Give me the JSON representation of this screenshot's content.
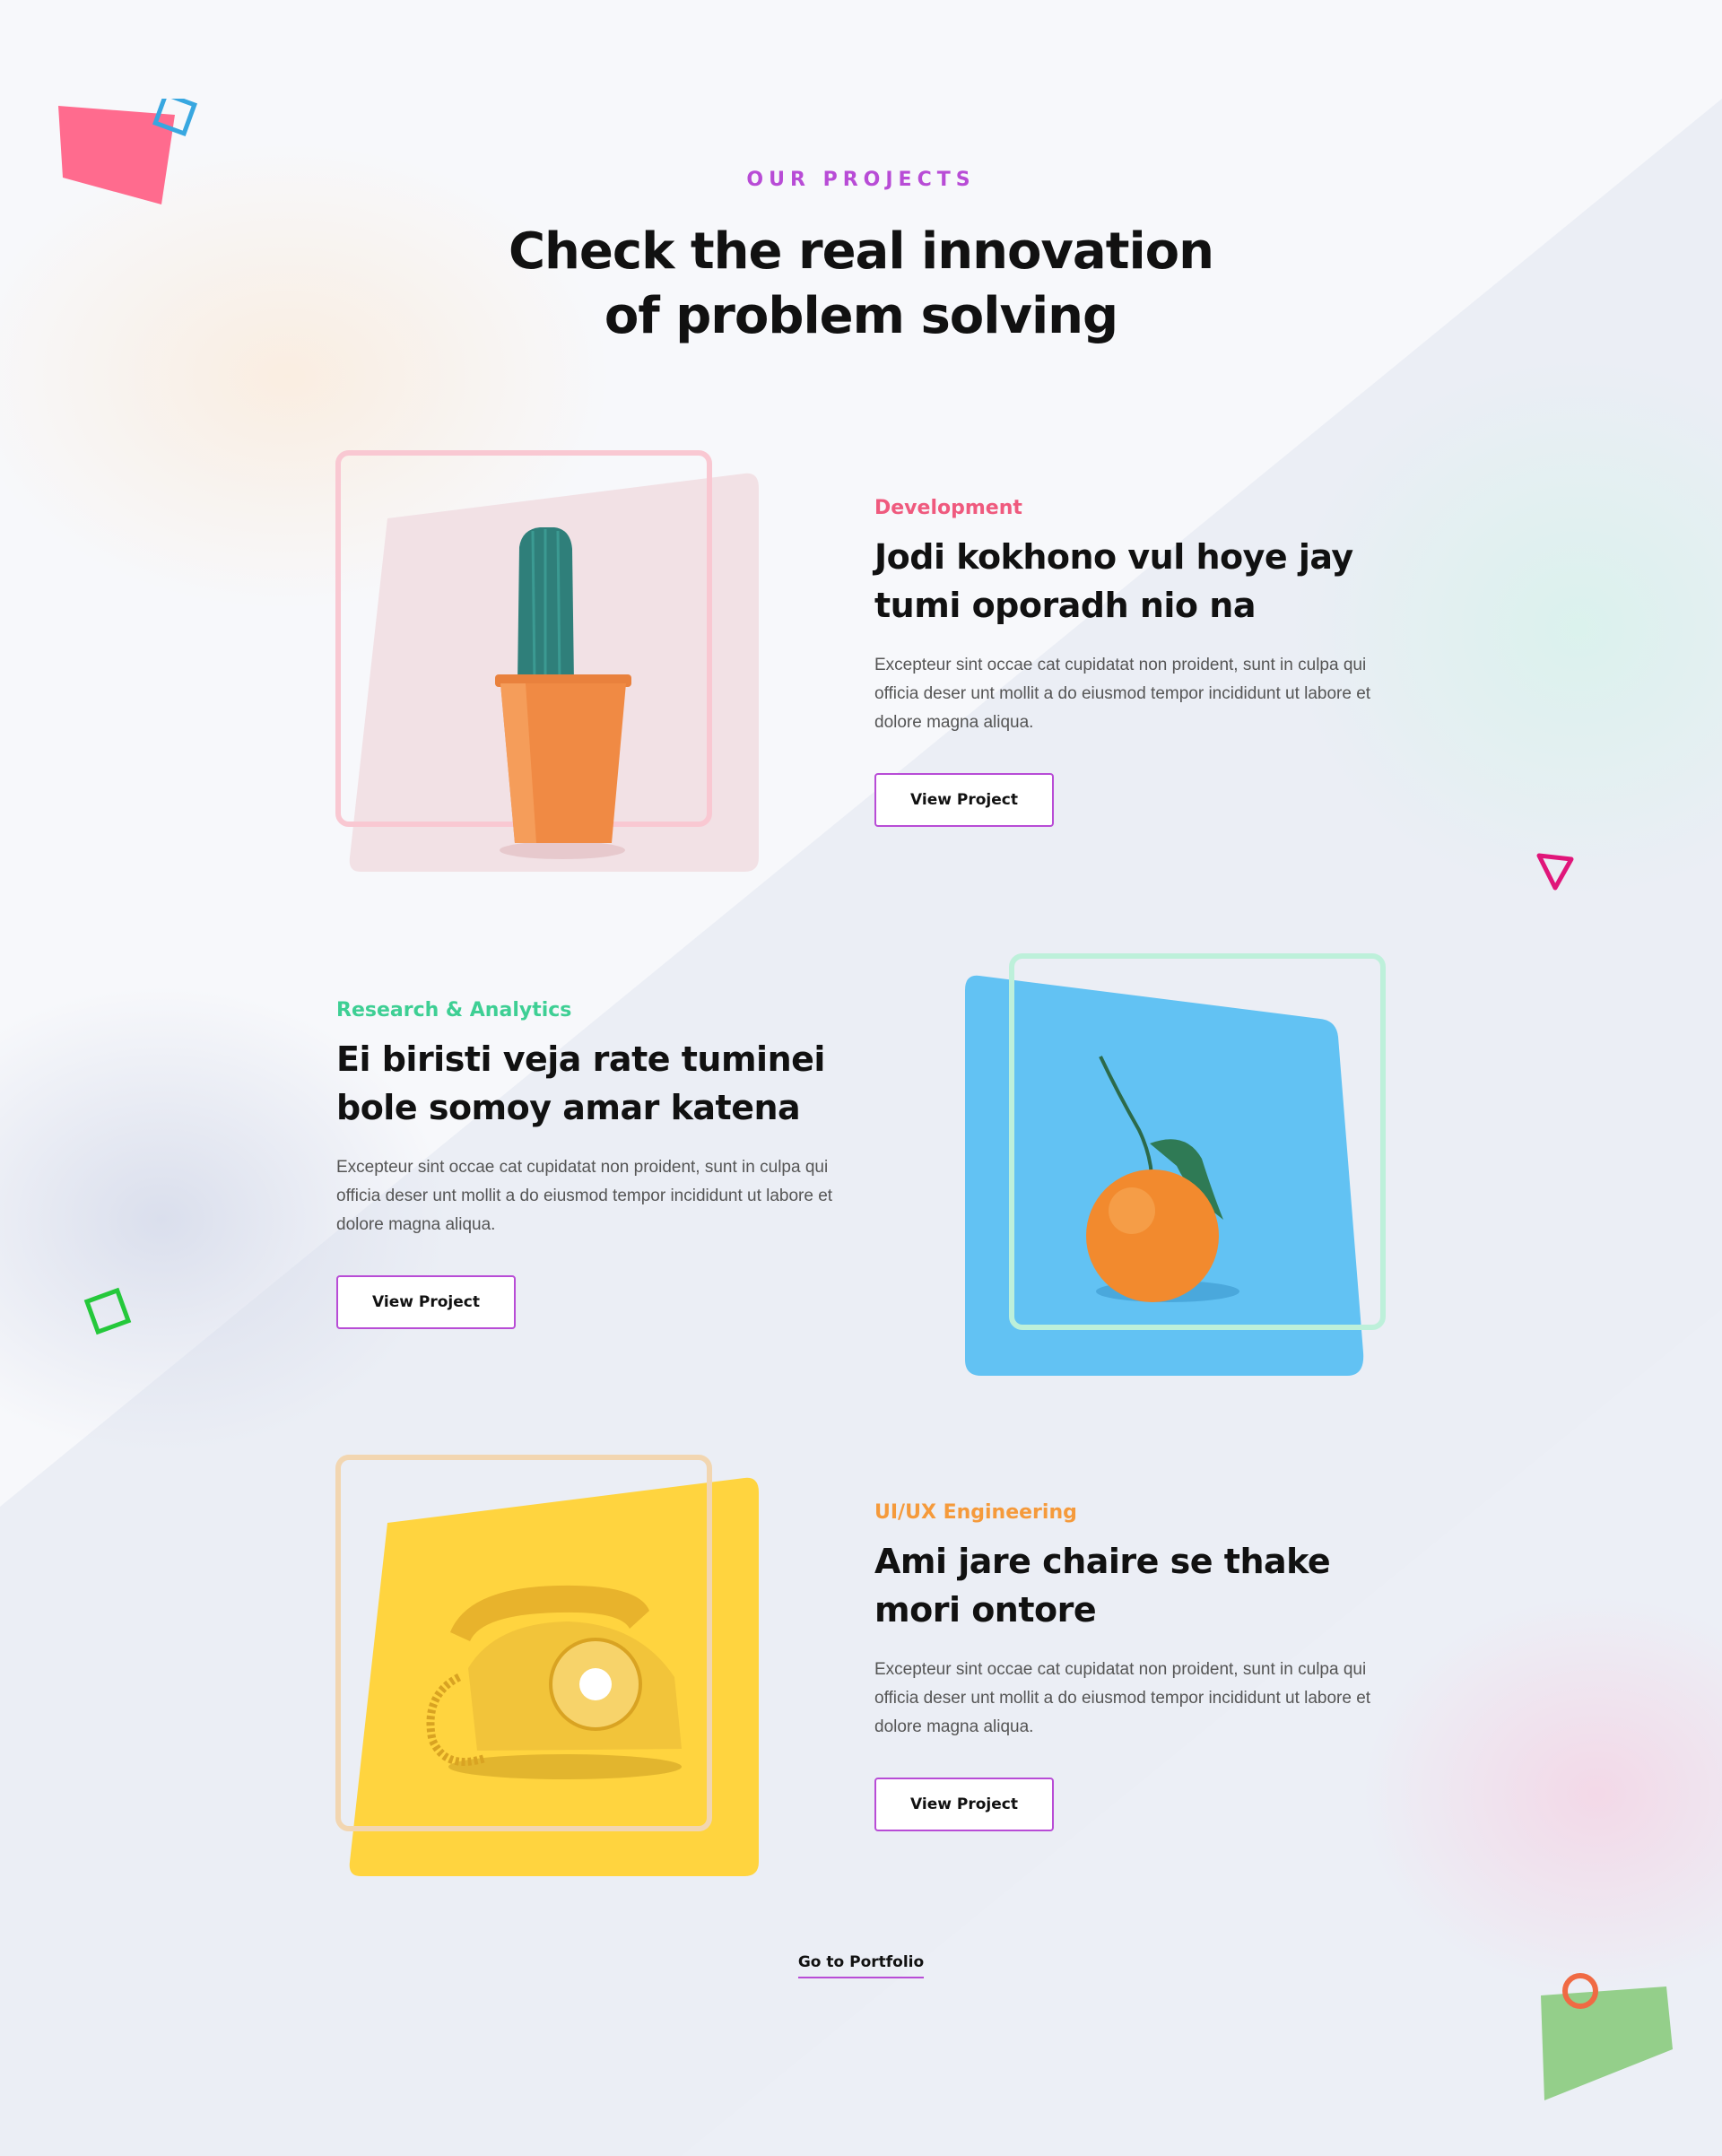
{
  "section": {
    "eyebrow": "OUR PROJECTS",
    "headline": "Check the real innovation of problem solving"
  },
  "projects": [
    {
      "category": "Development",
      "category_color": "#ef5a7e",
      "title": "Jodi kokhono vul hoye jay tumi oporadh nio na",
      "description": "Excepteur sint occae cat cupidatat non proident, sunt in culpa qui officia deser unt mollit a do eiusmod tempor incididunt ut labore et dolore magna aliqua.",
      "button": "View Project",
      "image_icon": "cactus-icon",
      "panel_color": "#f2e1e5",
      "frame_color": "#f9c8d2"
    },
    {
      "category": "Research & Analytics",
      "category_color": "#3ecf94",
      "title": "Ei biristi veja rate tuminei bole somoy amar katena",
      "description": "Excepteur sint occae cat cupidatat non proident, sunt in culpa qui officia deser unt mollit a do eiusmod tempor incididunt ut labore et dolore magna aliqua.",
      "button": "View Project",
      "image_icon": "orange-fruit-icon",
      "panel_color": "#62c2f3",
      "frame_color": "#bdf0da"
    },
    {
      "category": "UI/UX Engineering",
      "category_color": "#f59a3b",
      "title": "Ami jare chaire se thake mori ontore",
      "description": "Excepteur sint occae cat cupidatat non proident, sunt in culpa qui officia deser unt mollit a do eiusmod tempor incididunt ut labore et dolore magna aliqua.",
      "button": "View Project",
      "image_icon": "telephone-icon",
      "panel_color": "#ffd43f",
      "frame_color": "#f2d6b1"
    }
  ],
  "footer_link": "Go to Portfolio",
  "colors": {
    "accent": "#b84cd6",
    "background": "#f3f5f9"
  }
}
